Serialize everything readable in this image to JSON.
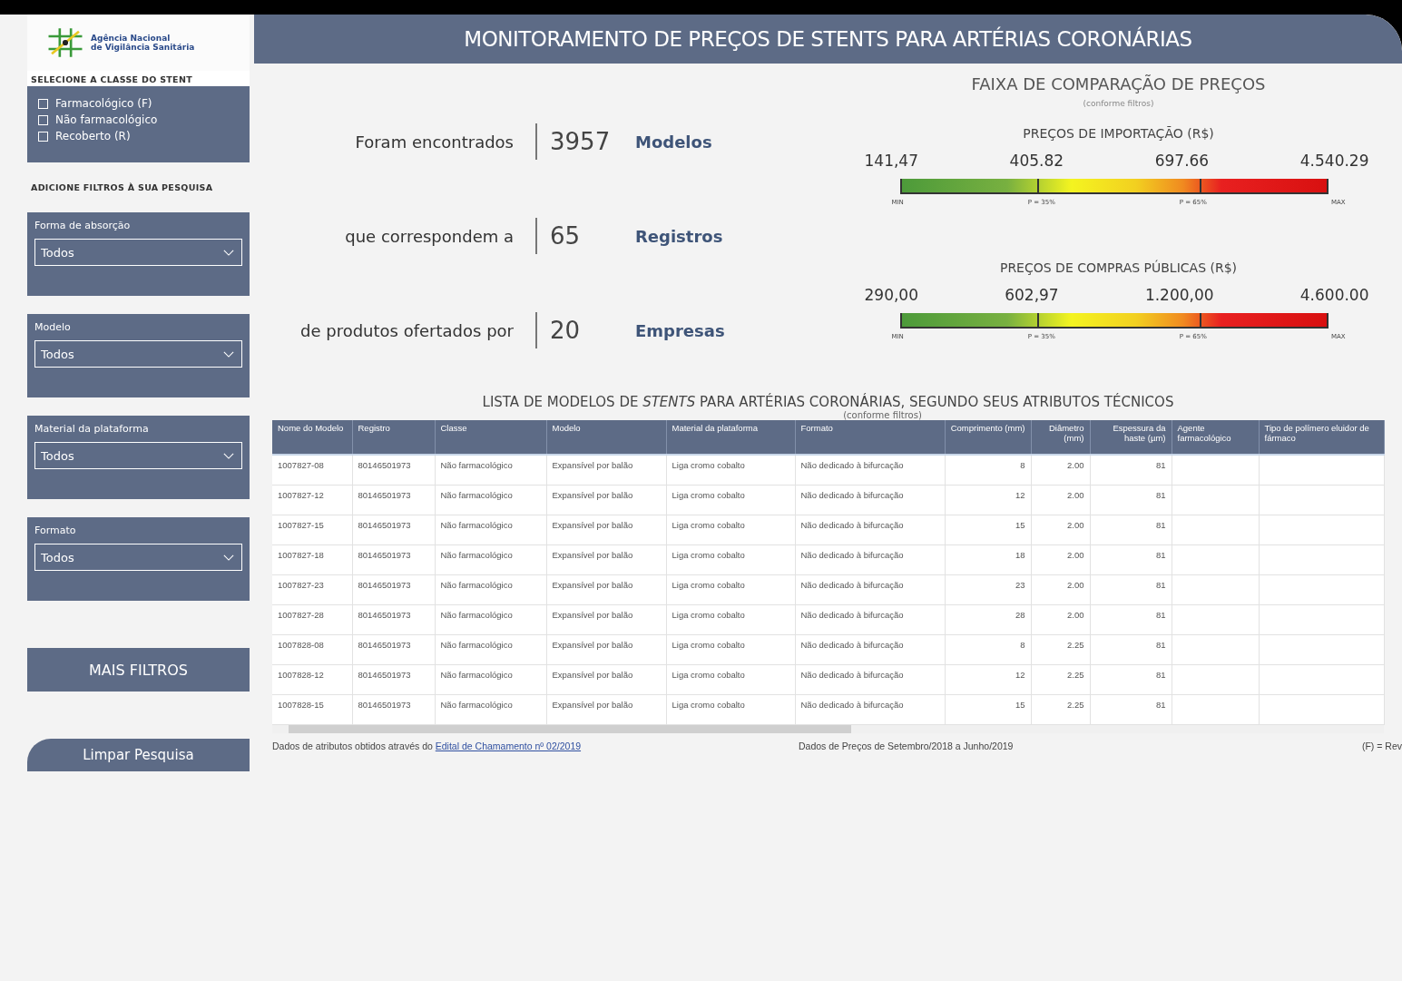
{
  "logo": {
    "lines": [
      "Agência Nacional",
      "de Vigilância Sanitária"
    ]
  },
  "header": {
    "title": "MONITORAMENTO DE PREÇOS DE STENTS PARA ARTÉRIAS CORONÁRIAS"
  },
  "sidebar": {
    "class_title": "SELECIONE A CLASSE DO STENT",
    "class_options": [
      {
        "label": "Farmacológico (F)",
        "checked": false
      },
      {
        "label": "Não farmacológico",
        "checked": false
      },
      {
        "label": "Recoberto (R)",
        "checked": false
      }
    ],
    "filters_title": "ADICIONE FILTROS À SUA PESQUISA",
    "filters": [
      {
        "label": "Forma de absorção",
        "value": "Todos"
      },
      {
        "label": "Modelo",
        "value": "Todos"
      },
      {
        "label": "Material da plataforma",
        "value": "Todos"
      },
      {
        "label": "Formato",
        "value": "Todos"
      }
    ],
    "more_button": "MAIS FILTROS",
    "clear_button": "Limpar Pesquisa"
  },
  "stats": [
    {
      "prefix": "Foram encontrados",
      "number": "3957",
      "unit": "Modelos"
    },
    {
      "prefix": "que correspondem a",
      "number": "65",
      "unit": "Registros"
    },
    {
      "prefix": "de produtos ofertados por",
      "number": "20",
      "unit": "Empresas"
    }
  ],
  "price_range": {
    "title": "FAIXA DE COMPARAÇÃO DE PREÇOS",
    "subtitle": "(conforme filtros)",
    "scales": [
      {
        "title": "PREÇOS DE IMPORTAÇÃO (R$)",
        "values": [
          "141,47",
          "405.82",
          "697.66",
          "4.540.29"
        ],
        "marks": [
          "MIN",
          "P = 35%",
          "P = 65%",
          "MAX"
        ]
      },
      {
        "title": "PREÇOS DE COMPRAS PÚBLICAS (R$)",
        "values": [
          "290,00",
          "602,97",
          "1.200,00",
          "4.600.00"
        ],
        "marks": [
          "MIN",
          "P = 35%",
          "P = 65%",
          "MAX"
        ]
      }
    ]
  },
  "table": {
    "title_before": "LISTA DE MODELOS DE ",
    "title_italic": "STENTS",
    "title_after": " PARA ARTÉRIAS CORONÁRIAS, SEGUNDO SEUS ATRIBUTOS TÉCNICOS",
    "subtitle": "(conforme filtros)",
    "columns": [
      "Nome do Modelo",
      "Registro",
      "Classe",
      "Modelo",
      "Material da plataforma",
      "Formato",
      "Comprimento (mm)",
      "Diâmetro (mm)",
      "Espessura da haste (µm)",
      "Agente farmacológico",
      "Tipo de polímero eluidor de fármaco"
    ],
    "rows": [
      [
        "1007827-08",
        "80146501973",
        "Não farmacológico",
        "Expansível por balão",
        "Liga cromo cobalto",
        "Não dedicado à bifurcação",
        "8",
        "2.00",
        "81",
        "",
        ""
      ],
      [
        "1007827-12",
        "80146501973",
        "Não farmacológico",
        "Expansível por balão",
        "Liga cromo cobalto",
        "Não dedicado à bifurcação",
        "12",
        "2.00",
        "81",
        "",
        ""
      ],
      [
        "1007827-15",
        "80146501973",
        "Não farmacológico",
        "Expansível por balão",
        "Liga cromo cobalto",
        "Não dedicado à bifurcação",
        "15",
        "2.00",
        "81",
        "",
        ""
      ],
      [
        "1007827-18",
        "80146501973",
        "Não farmacológico",
        "Expansível por balão",
        "Liga cromo cobalto",
        "Não dedicado à bifurcação",
        "18",
        "2.00",
        "81",
        "",
        ""
      ],
      [
        "1007827-23",
        "80146501973",
        "Não farmacológico",
        "Expansível por balão",
        "Liga cromo cobalto",
        "Não dedicado à bifurcação",
        "23",
        "2.00",
        "81",
        "",
        ""
      ],
      [
        "1007827-28",
        "80146501973",
        "Não farmacológico",
        "Expansível por balão",
        "Liga cromo cobalto",
        "Não dedicado à bifurcação",
        "28",
        "2.00",
        "81",
        "",
        ""
      ],
      [
        "1007828-08",
        "80146501973",
        "Não farmacológico",
        "Expansível por balão",
        "Liga cromo cobalto",
        "Não dedicado à bifurcação",
        "8",
        "2.25",
        "81",
        "",
        ""
      ],
      [
        "1007828-12",
        "80146501973",
        "Não farmacológico",
        "Expansível por balão",
        "Liga cromo cobalto",
        "Não dedicado à bifurcação",
        "12",
        "2.25",
        "81",
        "",
        ""
      ],
      [
        "1007828-15",
        "80146501973",
        "Não farmacológico",
        "Expansível por balão",
        "Liga cromo cobalto",
        "Não dedicado à bifurcação",
        "15",
        "2.25",
        "81",
        "",
        ""
      ]
    ]
  },
  "footer": {
    "source_text": "Dados de atributos obtidos através do ",
    "source_link": "Edital de Chamamento nº 02/2019",
    "period": "Dados de Preços de Setembro/2018 a Junho/2019",
    "legend": "(F) = Rev"
  }
}
